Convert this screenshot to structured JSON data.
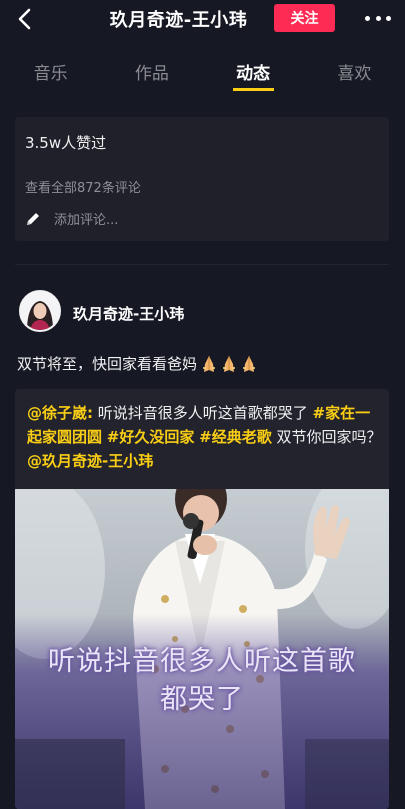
{
  "header": {
    "title": "玖月奇迹-王小玮",
    "follow_label": "关注"
  },
  "tabs": [
    {
      "label": "音乐",
      "active": false
    },
    {
      "label": "作品",
      "active": false
    },
    {
      "label": "动态",
      "active": true
    },
    {
      "label": "喜欢",
      "active": false
    }
  ],
  "comments_card": {
    "likes": "3.5w人赞过",
    "view_all": "查看全部872条评论",
    "add_placeholder": "添加评论..."
  },
  "post": {
    "author": "玖月奇迹-王小玮",
    "text": "双节将至，快回家看看爸妈",
    "emoji_count": 3,
    "repost": {
      "mention_user": "@徐子崴:",
      "body1": " 听说抖音很多人听这首歌都哭了 ",
      "tag1": "#家在一起家圆团圆",
      "tag2": "#好久没回家",
      "tag3": "#经典老歌",
      "body2": " 双节你回家吗？",
      "mention_end": "@玖月奇迹-王小玮",
      "caption_line1": "听说抖音很多人听这首歌",
      "caption_line2": "都哭了"
    }
  },
  "colors": {
    "background": "#161823",
    "accent": "#face15",
    "follow": "#fe2c55"
  }
}
